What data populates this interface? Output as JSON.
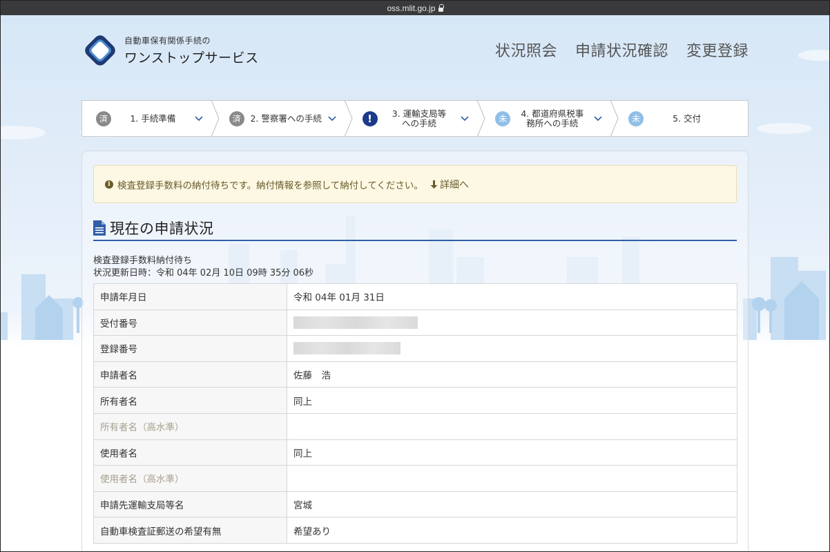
{
  "browser": {
    "url": "oss.mlit.go.jp"
  },
  "header": {
    "logo_sub": "自動車保有関係手続の",
    "logo_main": "ワンストップサービス",
    "nav": [
      {
        "label": "状況照会"
      },
      {
        "label": "申請状況確認"
      },
      {
        "label": "変更登録"
      }
    ]
  },
  "steps": [
    {
      "badge": "済",
      "status": "done",
      "label": "1. 手続準備"
    },
    {
      "badge": "済",
      "status": "done",
      "label": "2. 警察署への手続"
    },
    {
      "badge": "!",
      "status": "alert",
      "label": "3. 運輸支局等への手続"
    },
    {
      "badge": "未",
      "status": "todo",
      "label": "4. 都道府県税事務所への手続"
    },
    {
      "badge": "未",
      "status": "todo",
      "label": "5. 交付"
    }
  ],
  "notice": {
    "text": "検査登録手数料の納付待ちです。納付情報を参照して納付してください。",
    "link": "詳細へ"
  },
  "section": {
    "title": "現在の申請状況"
  },
  "status": {
    "line1": "検査登録手数料納付待ち",
    "line2": "状況更新日時：令和 04年 02月 10日 09時 35分 06秒"
  },
  "table": [
    {
      "key": "申請年月日",
      "value": "令和 04年 01月 31日"
    },
    {
      "key": "受付番号",
      "value": ""
    },
    {
      "key": "登録番号",
      "value": ""
    },
    {
      "key": "申請者名",
      "value": "佐藤　浩"
    },
    {
      "key": "所有者名",
      "value": "同上"
    },
    {
      "key": "所有者名（高水準）",
      "value": ""
    },
    {
      "key": "使用者名",
      "value": "同上"
    },
    {
      "key": "使用者名（高水準）",
      "value": ""
    },
    {
      "key": "申請先運輸支局等名",
      "value": "宮城"
    },
    {
      "key": "自動車検査証郵送の希望有無",
      "value": "希望あり"
    }
  ]
}
